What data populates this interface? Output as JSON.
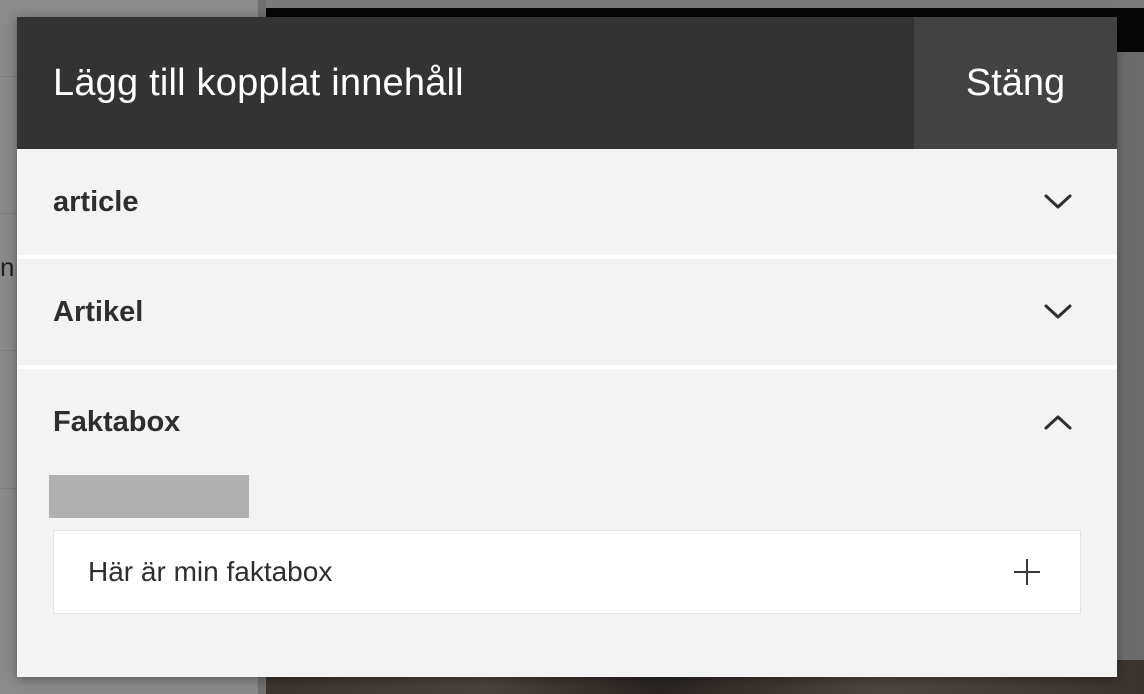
{
  "background": {
    "left_partial_text": "n"
  },
  "modal": {
    "title": "Lägg till kopplat innehåll",
    "close_label": "Stäng",
    "sections": [
      {
        "title": "article",
        "expanded": false,
        "chevron_icon": "chevron-down-icon"
      },
      {
        "title": "Artikel",
        "expanded": false,
        "chevron_icon": "chevron-down-icon"
      },
      {
        "title": "Faktabox",
        "expanded": true,
        "chevron_icon": "chevron-up-icon",
        "items": [
          {
            "label": "Här är min faktabox",
            "action_icon": "plus-icon"
          }
        ]
      }
    ]
  },
  "colors": {
    "header_bg": "#333333",
    "close_bg": "#424242",
    "panel_bg": "#f3f3f3",
    "item_bg": "#ffffff",
    "text": "#2e2e2e"
  }
}
